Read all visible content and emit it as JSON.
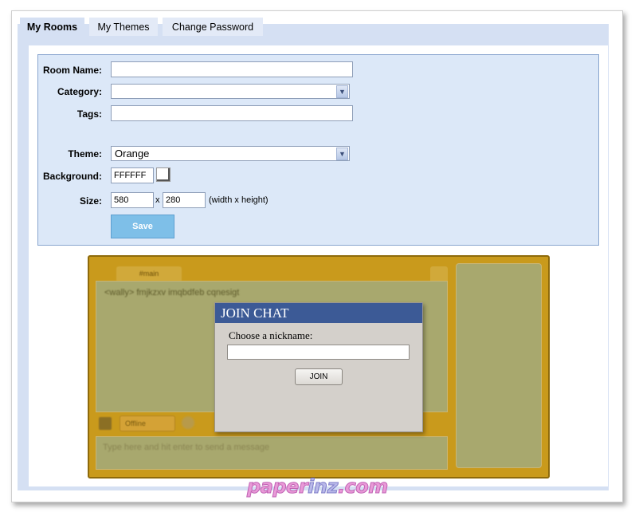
{
  "tabs": [
    {
      "label": "My Rooms",
      "active": true
    },
    {
      "label": "My Themes",
      "active": false
    },
    {
      "label": "Change Password",
      "active": false
    }
  ],
  "form": {
    "room_name_label": "Room Name:",
    "room_name_value": "",
    "category_label": "Category:",
    "category_value": "",
    "tags_label": "Tags:",
    "tags_value": "",
    "theme_label": "Theme:",
    "theme_value": "Orange",
    "background_label": "Background:",
    "background_value": "FFFFFF",
    "size_label": "Size:",
    "width_value": "580",
    "size_separator": "x",
    "height_value": "280",
    "size_hint": "(width x height)",
    "save_label": "Save"
  },
  "chat_preview": {
    "tab_label": "#main",
    "message_text": "<wally> fmjkzxv imqbdfeb cqnesigt",
    "status_label": "Offline",
    "input_placeholder": "Type here and hit enter to send a message"
  },
  "join_dialog": {
    "title": "JOIN CHAT",
    "nickname_label": "Choose a nickname:",
    "nickname_value": "",
    "join_label": "JOIN"
  },
  "watermark": {
    "part1": "paper",
    "part2": "inz",
    "part3": ".com"
  },
  "colors": {
    "panel_bg": "#d5e0f3",
    "form_bg": "#dce8f8",
    "save_button": "#7ebfe8",
    "chat_theme": "#c99a1c",
    "dialog_title_bar": "#3c5a96"
  }
}
